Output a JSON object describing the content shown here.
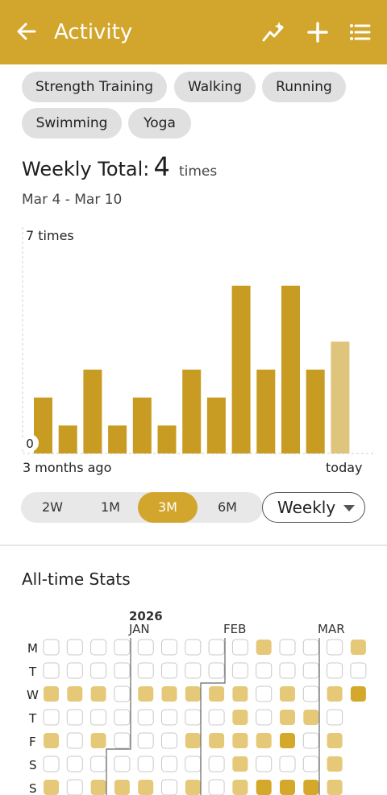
{
  "header": {
    "title": "Activity",
    "back_icon": "arrow-left-icon",
    "actions": [
      "trend-sparkle-icon",
      "plus-icon",
      "list-icon"
    ],
    "accent": "#d2a52c"
  },
  "filters": [
    "Strength Training",
    "Walking",
    "Running",
    "Swimming",
    "Yoga"
  ],
  "summary": {
    "label": "Weekly Total:",
    "value": "4",
    "unit": "times",
    "range": "Mar 4 - Mar 10"
  },
  "chart_data": {
    "type": "bar",
    "ylim": [
      0,
      7
    ],
    "y_max_label": "7 times",
    "y_min_label": "0",
    "x_start_label": "3 months ago",
    "x_end_label": "today",
    "values": [
      2,
      1,
      3,
      1,
      2,
      1,
      3,
      2,
      6,
      3,
      6,
      3,
      4
    ],
    "bar_color": "#c89b22",
    "current_bar_color": "#dfc47c",
    "grid": false
  },
  "period_tabs": [
    "2W",
    "1M",
    "3M",
    "6M"
  ],
  "period_selected": "3M",
  "grouping": "Weekly",
  "stats": {
    "title": "All-time Stats",
    "year": "2026",
    "months": [
      "JAN",
      "FEB",
      "MAR"
    ],
    "day_labels": [
      "M",
      "T",
      "W",
      "T",
      "F",
      "S",
      "S"
    ],
    "levels": [
      [
        0,
        0,
        0,
        0,
        0,
        0,
        0,
        0,
        0,
        1,
        0,
        0,
        0,
        1
      ],
      [
        0,
        0,
        0,
        0,
        0,
        0,
        0,
        0,
        0,
        0,
        0,
        0,
        0,
        0
      ],
      [
        1,
        1,
        1,
        0,
        1,
        1,
        1,
        1,
        1,
        0,
        1,
        0,
        1,
        2
      ],
      [
        0,
        0,
        0,
        0,
        0,
        0,
        0,
        0,
        1,
        0,
        1,
        1,
        0,
        null
      ],
      [
        1,
        0,
        1,
        0,
        0,
        0,
        1,
        1,
        1,
        1,
        2,
        0,
        1,
        null
      ],
      [
        0,
        0,
        0,
        0,
        0,
        0,
        0,
        0,
        1,
        0,
        0,
        0,
        1,
        null
      ],
      [
        1,
        0,
        1,
        1,
        1,
        0,
        1,
        0,
        1,
        2,
        2,
        2,
        1,
        null
      ]
    ],
    "colors": {
      "empty": "#ffffff",
      "light": "#e5c978",
      "dark": "#d4a82a"
    }
  }
}
